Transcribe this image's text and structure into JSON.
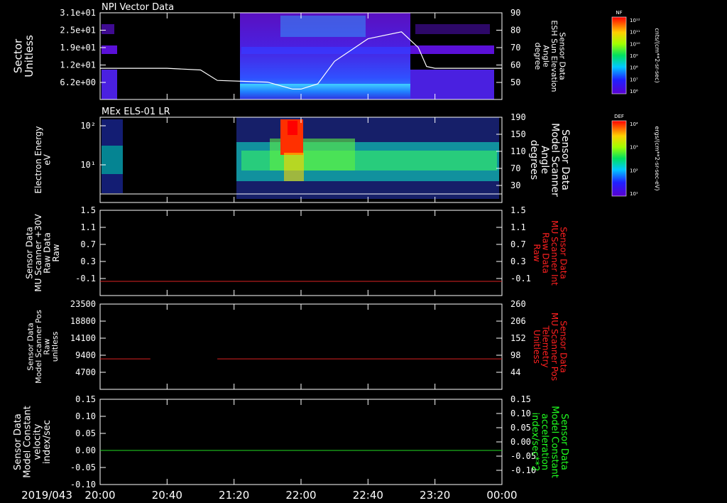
{
  "time_axis": {
    "date_label": "2019/043",
    "ticks": [
      "20:00",
      "20:40",
      "21:20",
      "22:00",
      "22:40",
      "23:20",
      "00:00"
    ],
    "range": [
      "20:00",
      "00:00"
    ]
  },
  "colors": {
    "axis": "#ffffff",
    "red_trace": "#dd2222",
    "green_trace": "#22dd22",
    "red_label": "#ff2020",
    "green_label": "#20ff20"
  },
  "colorbars": [
    {
      "title": "NF",
      "units": "cnts/(cm**2-sr-sec)",
      "ticks": [
        "10¹²",
        "10¹¹",
        "10¹⁰",
        "10⁹",
        "10⁸",
        "10⁷",
        "10⁶"
      ]
    },
    {
      "title": "DEF",
      "units": "ergs/(cm**2-sr-sec-eV)",
      "ticks": [
        "10⁴",
        "10³",
        "10²",
        "10¹"
      ]
    }
  ],
  "chart_data": [
    {
      "type": "heatmap",
      "title": "NPI Vector Data",
      "ylabel": [
        "Sector",
        "Unitless"
      ],
      "yticks": [
        "3.1e+01",
        "2.5e+01",
        "1.9e+01",
        "1.2e+01",
        "6.2e+00"
      ],
      "right_ylabel": [
        "Sensor Data",
        "ESH Sun Elevation",
        "Angle",
        "degree"
      ],
      "right_yticks": [
        "90",
        "80",
        "70",
        "60",
        "50"
      ],
      "right_ylim": [
        40,
        90
      ],
      "line_series": {
        "x": [
          "20:00",
          "20:40",
          "21:00",
          "21:10",
          "21:40",
          "21:55",
          "22:00",
          "22:10",
          "22:20",
          "22:40",
          "23:00",
          "23:10",
          "23:15",
          "23:20",
          "00:00"
        ],
        "values": [
          58,
          58,
          57,
          51,
          50,
          46,
          46,
          49,
          62,
          75,
          79,
          70,
          59,
          58,
          58
        ]
      }
    },
    {
      "type": "heatmap",
      "title": "MEx ELS-01 LR",
      "ylabel": [
        "Electron Energy",
        "eV"
      ],
      "yticks": [
        "10²",
        "10¹"
      ],
      "right_ylabel": [
        "Sensor Data",
        "Model Scanner",
        "Angle",
        "degrees"
      ],
      "right_yticks": [
        "190",
        "150",
        "110",
        "70",
        "30"
      ],
      "right_ylim": [
        0,
        190
      ],
      "line_series": {
        "x": [
          "20:00",
          "00:00"
        ],
        "values": [
          0,
          0
        ]
      }
    },
    {
      "type": "line",
      "ylabel": [
        "Sensor Data",
        "MU Scanner +30V",
        "Raw Data",
        "Raw"
      ],
      "yticks": [
        "1.5",
        "1.1",
        "0.7",
        "0.3",
        "-0.1"
      ],
      "ylim": [
        -0.3,
        1.5
      ],
      "right_ylabel": [
        "Sensor Data",
        "MU Scanner Int",
        "Raw Data",
        "Raw"
      ],
      "right_yticks": [
        "1.5",
        "1.1",
        "0.7",
        "0.3",
        "-0.1"
      ],
      "series": [
        {
          "x": [
            "20:00",
            "00:00"
          ],
          "values": [
            0,
            0
          ]
        }
      ]
    },
    {
      "type": "line",
      "ylabel": [
        "Sensor Data",
        "Model Scanner Pos",
        "Raw",
        "unitless"
      ],
      "yticks": [
        "23500",
        "18800",
        "14100",
        "9400",
        "4700"
      ],
      "ylim": [
        0,
        23500
      ],
      "right_ylabel": [
        "Sensor Data",
        "MU Scanner Pos",
        "Telemetry",
        "Unitless"
      ],
      "right_yticks": [
        "260",
        "206",
        "152",
        "98",
        "44"
      ],
      "right_ylim": [
        -10,
        260
      ],
      "series": [
        {
          "x": [
            "20:00",
            "20:30"
          ],
          "values": [
            8400,
            8400
          ]
        },
        {
          "x": [
            "21:10",
            "00:00"
          ],
          "values": [
            8400,
            8400
          ]
        }
      ]
    },
    {
      "type": "line",
      "ylabel": [
        "Sensor Data",
        "Model Constant",
        "velocity",
        "index/sec"
      ],
      "yticks": [
        "0.15",
        "0.10",
        "0.05",
        "0.00",
        "-0.05",
        "-0.10"
      ],
      "ylim": [
        -0.1,
        0.15
      ],
      "right_ylabel": [
        "Sensor Data",
        "Model Constant",
        "acceleration",
        "index/sec**2"
      ],
      "right_yticks": [
        "0.15",
        "0.10",
        "0.05",
        "0.00",
        "-0.05",
        "-0.10"
      ],
      "series": [
        {
          "x": [
            "20:00",
            "00:00"
          ],
          "values": [
            0,
            0
          ]
        }
      ]
    }
  ]
}
